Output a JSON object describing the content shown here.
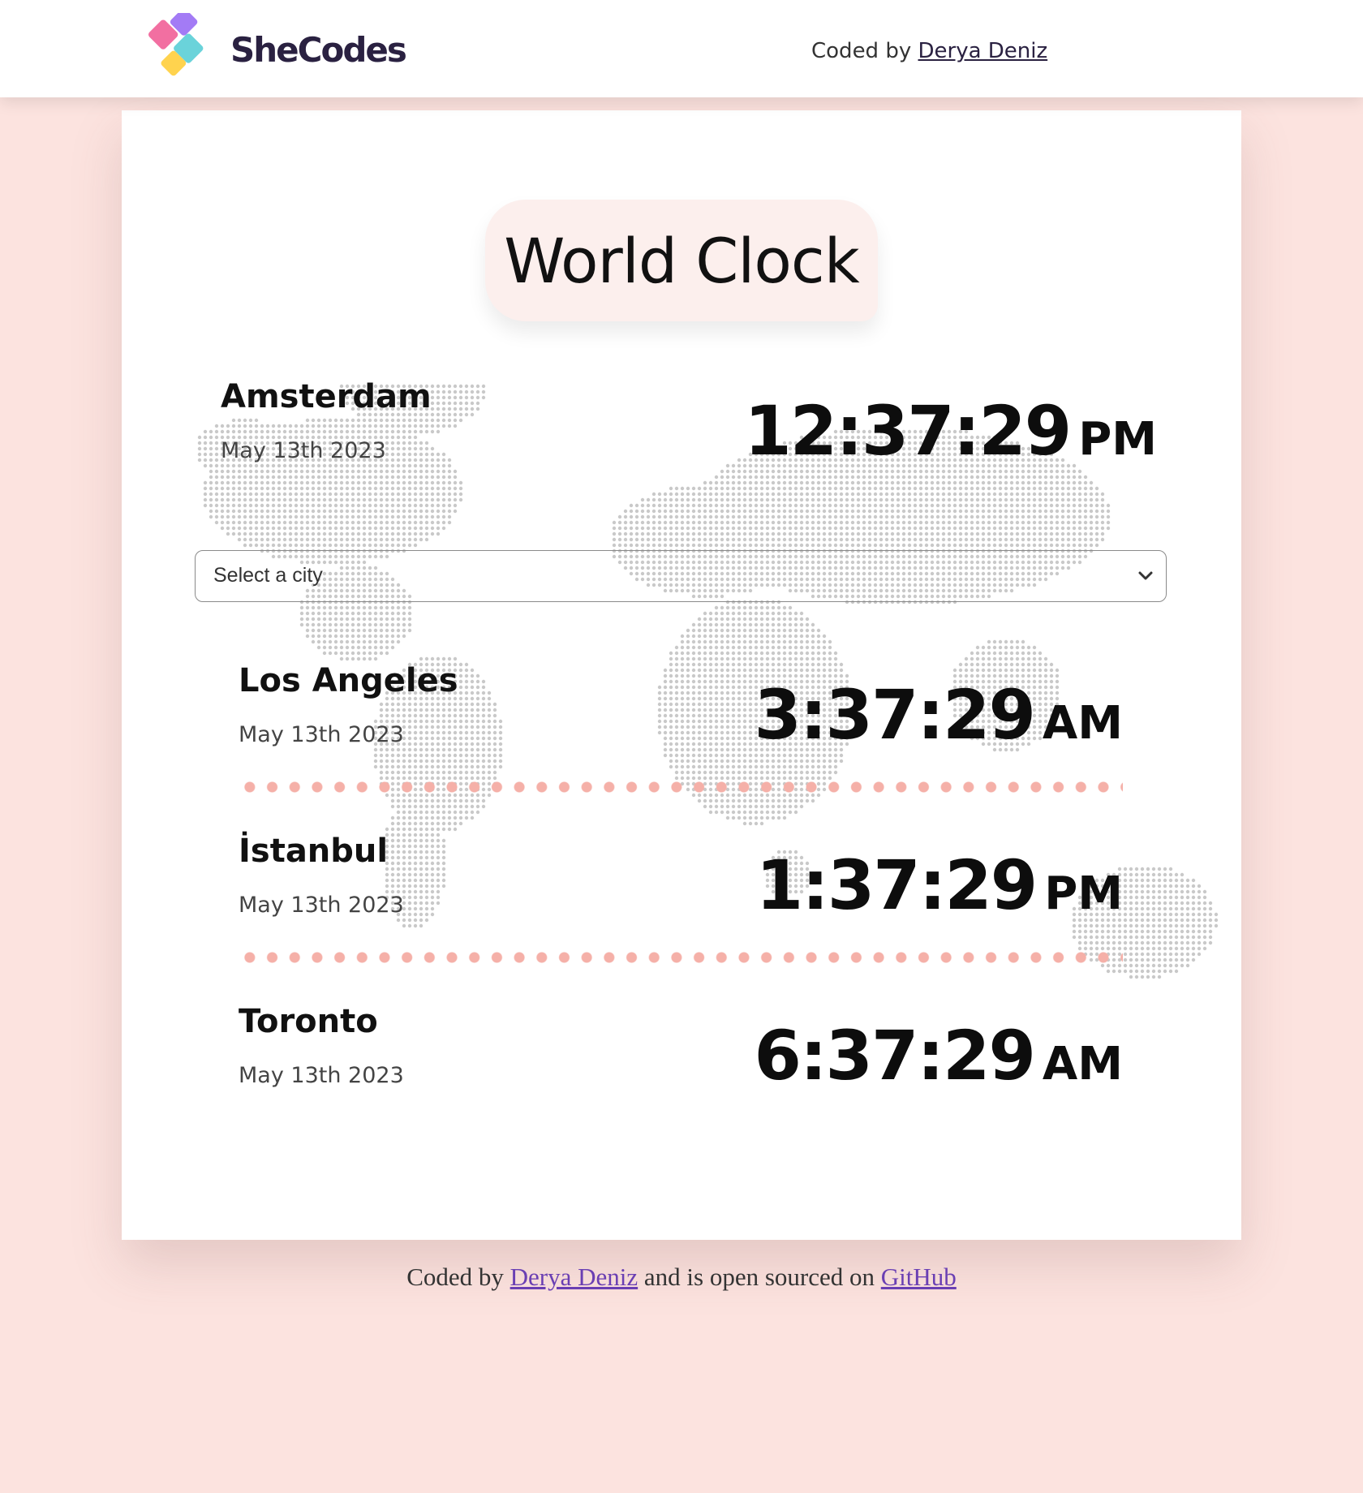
{
  "header": {
    "brand": "SheCodes",
    "coded_by_prefix": "Coded by",
    "author_link": "Derya Deniz"
  },
  "card": {
    "title": "World Clock",
    "cities": [
      {
        "name": "Amsterdam",
        "date": "May 13th 2023",
        "time": "12:37:29",
        "period": "PM"
      },
      {
        "name": "Los Angeles",
        "date": "May 13th 2023",
        "time": "3:37:29",
        "period": "AM"
      },
      {
        "name": "İstanbul",
        "date": "May 13th 2023",
        "time": "1:37:29",
        "period": "PM"
      },
      {
        "name": "Toronto",
        "date": "May 13th 2023",
        "time": "6:37:29",
        "period": "AM"
      }
    ],
    "city_select": {
      "placeholder": "Select a city"
    }
  },
  "footer": {
    "prefix": "Coded by",
    "author_link": "Derya Deniz",
    "middle": "and is open sourced on",
    "repo_link": "GitHub"
  },
  "colors": {
    "page_background": "#fce3df",
    "divider_dots": "#f5b0a8",
    "title_pill": "#fcefed",
    "footer_link": "#6a3fb3"
  }
}
